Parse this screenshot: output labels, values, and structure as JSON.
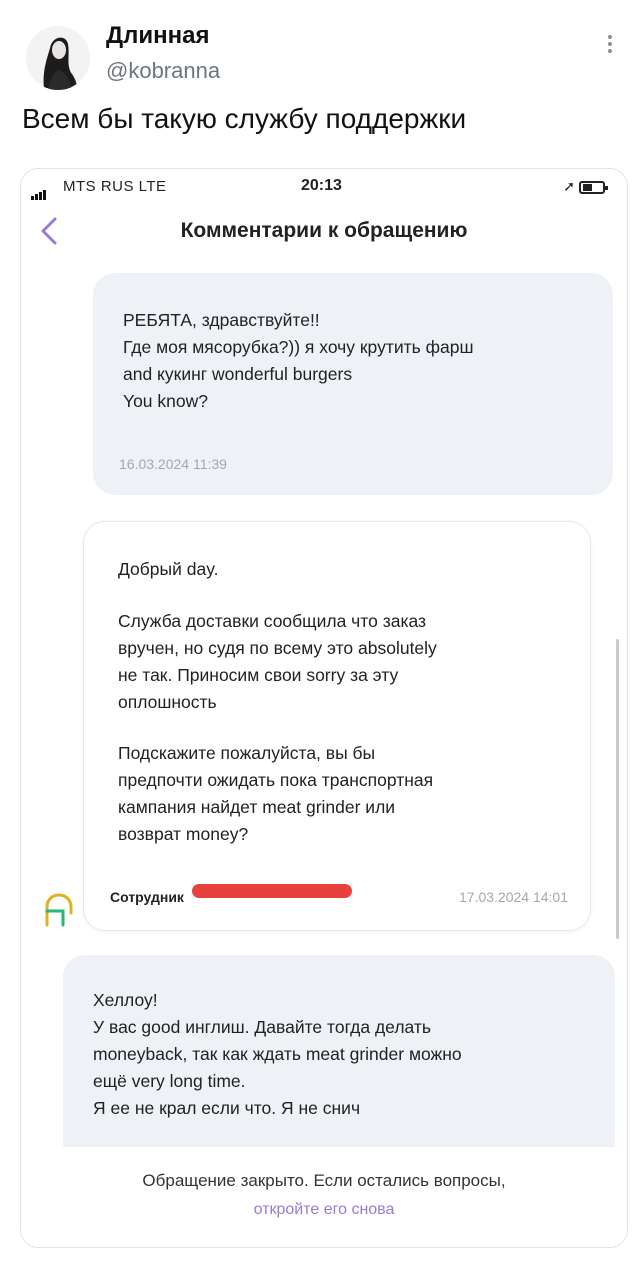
{
  "tweet": {
    "author_name": "Длинная",
    "author_handle": "@kobranna",
    "text": "Всем бы такую службу поддержки"
  },
  "screenshot": {
    "status_bar": {
      "carrier": "MTS RUS  LTE",
      "time": "20:13"
    },
    "header": {
      "title": "Комментарии к обращению"
    },
    "messages": [
      {
        "from": "user",
        "lines": [
          "РЕБЯТА, здравствуйте!!",
          "Где моя мясорубка?)) я хочу крутить фарш",
          "and кукинг wonderful burgers",
          "You know?"
        ],
        "timestamp": "16.03.2024 11:39"
      },
      {
        "from": "staff",
        "greeting": "Добрый day.",
        "paragraph1": [
          "Служба доставки сообщила что заказ",
          "вручен, но судя по всему это absolutely",
          "не так. Приносим свои sorry за эту",
          "оплошность"
        ],
        "paragraph2": [
          "Подскажите пожалуйста, вы бы",
          "предпочти ожидать пока транспортная",
          "кампания найдет meat grinder или",
          "возврат money?"
        ],
        "staff_label": "Сотрудник",
        "timestamp": "17.03.2024 14:01"
      },
      {
        "from": "user",
        "lines": [
          "Хеллоу!",
          "У вас good инглиш. Давайте тогда делать",
          "moneyback, так как ждать meat grinder можно",
          "ещё very long time.",
          "Я ее не крал если что. Я не снич"
        ]
      }
    ],
    "footer": {
      "closed_text": "Обращение закрыто. Если остались вопросы,",
      "reopen_link": "откройте его снова"
    }
  },
  "colors": {
    "accent_purple": "#9a7ad8",
    "user_bubble": "#eef1f5",
    "redaction": "#e8403a"
  }
}
